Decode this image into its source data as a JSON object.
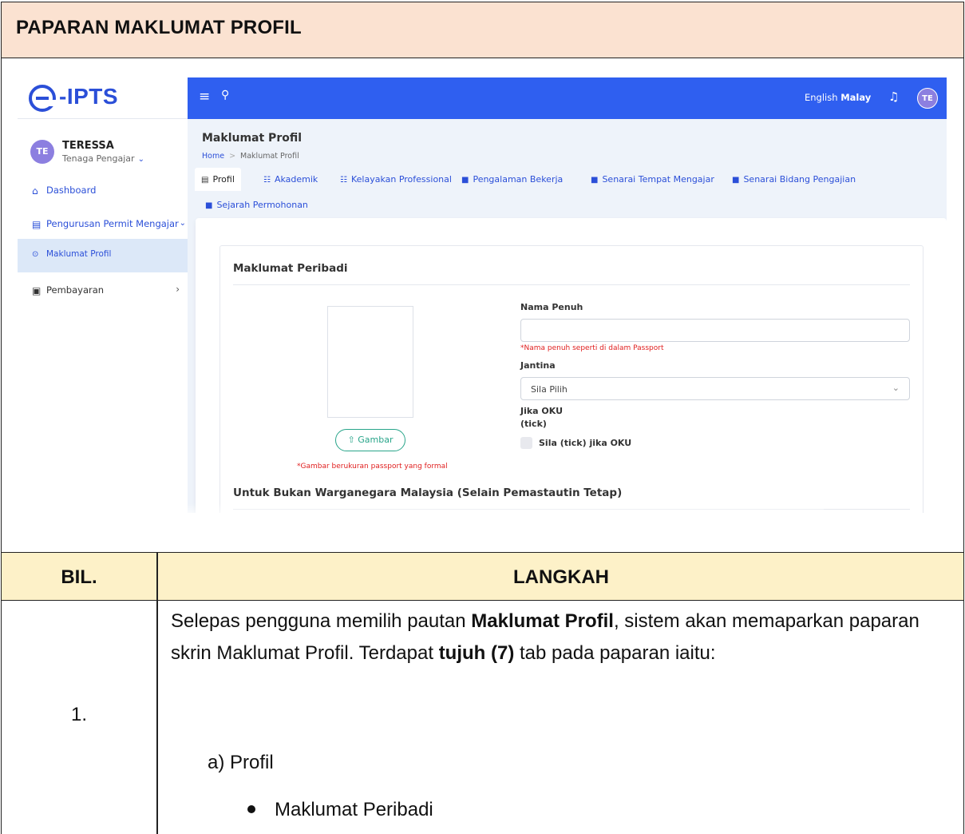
{
  "section_title": "PAPARAN MAKLUMAT PROFIL",
  "screenshot": {
    "logo": "-IPTS",
    "topbar": {
      "lang_english": "English",
      "lang_malay": "Malay",
      "avatar": "TE"
    },
    "user": {
      "initials": "TE",
      "name": "TERESSA",
      "role": "Tenaga Pengajar"
    },
    "sidebar": [
      {
        "label": "Dashboard"
      },
      {
        "label": "Pengurusan Permit Mengajar"
      },
      {
        "label": "Maklumat Profil"
      },
      {
        "label": "Pembayaran"
      }
    ],
    "page_title": "Maklumat Profil",
    "breadcrumb": {
      "home": "Home",
      "current": "Maklumat Profil"
    },
    "tabs": [
      "Profil",
      "Akademik",
      "Kelayakan Professional",
      "Pengalaman Bekerja",
      "Senarai Tempat Mengajar",
      "Senarai Bidang Pengajian",
      "Sejarah Permohonan"
    ],
    "form": {
      "section_title": "Maklumat Peribadi",
      "upload_label": "Gambar",
      "photo_note": "*Gambar berukuran passport yang formal",
      "nama_label": "Nama Penuh",
      "nama_value": "",
      "nama_note": "*Nama penuh seperti di dalam Passport",
      "jantina_label": "Jantina",
      "jantina_value": "Sila Pilih",
      "oku_label": "Jika OKU",
      "oku_sub": "(tick)",
      "oku_checkbox_label": "Sila (tick) jika OKU",
      "subsection_title": "Untuk Bukan Warganegara Malaysia (Selain Pemastautin Tetap)"
    }
  },
  "steps_table": {
    "header_bil": "BIL.",
    "header_langkah": "LANGKAH",
    "row": {
      "bil": "1.",
      "text_1": "Selepas pengguna memilih pautan ",
      "bold_1": "Maklumat Profil",
      "text_2": ", sistem akan memaparkan paparan skrin Maklumat Profil. Terdapat ",
      "bold_2": "tujuh (7)",
      "text_3": " tab pada paparan iaitu:",
      "list_item": "a)  Profil",
      "bullet": "Maklumat Peribadi"
    }
  }
}
